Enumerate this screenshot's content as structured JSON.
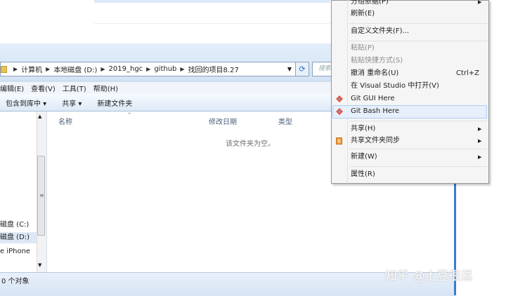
{
  "address_bar": {
    "crumbs": [
      "计算机",
      "本地磁盘 (D:)",
      "2019_hgc",
      "github",
      "找回的项目8.27"
    ],
    "search_placeholder": "搜索"
  },
  "menu_bar": [
    "编辑(E)",
    "查看(V)",
    "工具(T)",
    "帮助(H)"
  ],
  "toolbar": {
    "include": "包含到库中 ▾",
    "share": "共享 ▾",
    "new_folder": "新建文件夹"
  },
  "nav": {
    "items": [
      "磁盘 (C:)",
      "磁盘 (D:)",
      "e iPhone"
    ]
  },
  "columns": {
    "name": "名称",
    "modified": "修改日期",
    "type": "类型"
  },
  "empty_text": "该文件夹为空。",
  "status": "0 个对象",
  "context_menu": {
    "items": [
      {
        "label": "分组依据(P)",
        "submenu": true
      },
      {
        "label": "刷新(E)"
      },
      {
        "label": "自定义文件夹(F)..."
      },
      {
        "label": "粘贴(P)",
        "disabled": true
      },
      {
        "label": "粘贴快捷方式(S)",
        "disabled": true
      },
      {
        "label": "撤消 重命名(U)",
        "shortcut": "Ctrl+Z"
      },
      {
        "label": "在 Visual Studio 中打开(V)"
      },
      {
        "label": "Git GUI Here",
        "icon": "git-icon"
      },
      {
        "label": "Git Bash Here",
        "icon": "git-icon",
        "highlighted": true
      },
      {
        "label": "共享(H)",
        "submenu": true
      },
      {
        "label": "共享文件夹同步",
        "submenu": true,
        "icon": "sync-icon"
      },
      {
        "label": "新建(W)",
        "submenu": true
      },
      {
        "label": "属性(R)"
      }
    ]
  },
  "watermark": "知乎 @土豆很逗",
  "colors": {
    "window_frame": "#cfdff0",
    "highlight": "#e6effa",
    "accent_blue": "#3a7bd5"
  }
}
